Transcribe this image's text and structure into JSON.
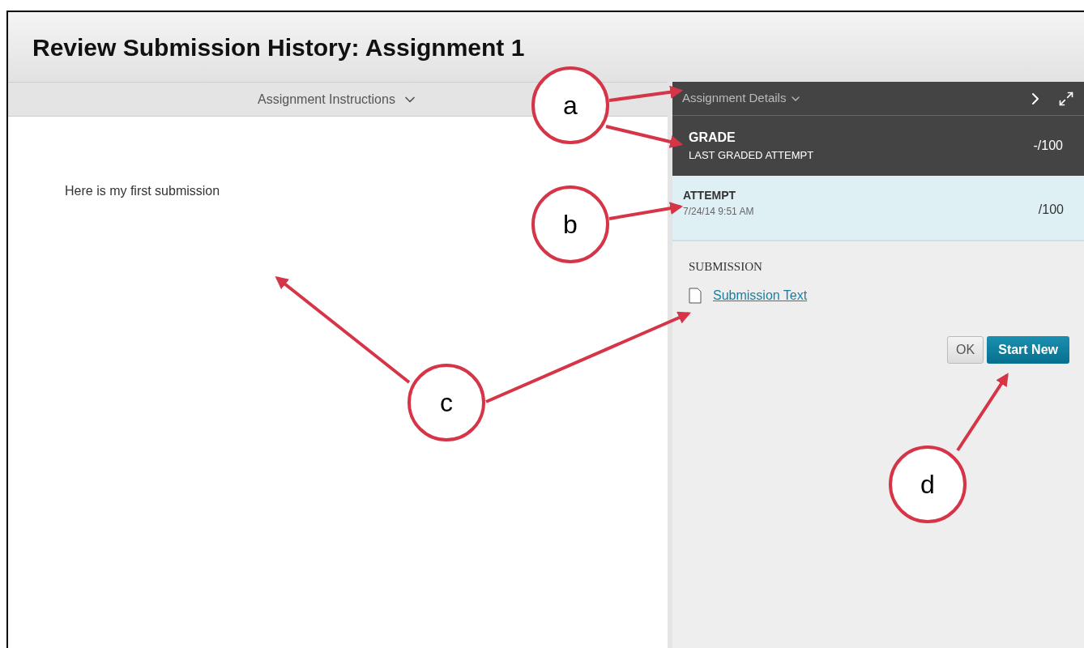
{
  "page_title": "Review Submission History: Assignment 1",
  "left_panel": {
    "header": "Assignment Instructions",
    "body": "Here is my first submission"
  },
  "right_panel": {
    "header": "Assignment Details",
    "grade": {
      "label": "GRADE",
      "sublabel": "LAST GRADED ATTEMPT",
      "score": "-/100"
    },
    "attempt": {
      "label": "ATTEMPT",
      "date": "7/24/14 9:51 AM",
      "score": "/100",
      "selected": true
    },
    "submission": {
      "heading": "SUBMISSION",
      "link": "Submission Text"
    },
    "buttons": [
      {
        "label": "OK",
        "kind": "secondary"
      },
      {
        "label": "Start New",
        "kind": "primary"
      }
    ]
  },
  "callouts": [
    {
      "label": "a"
    },
    {
      "label": "b"
    },
    {
      "label": "c"
    },
    {
      "label": "d"
    }
  ]
}
